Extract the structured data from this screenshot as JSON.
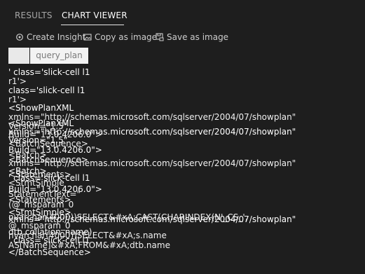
{
  "tabs": {
    "results": "RESULTS",
    "chart_viewer": "CHART VIEWER"
  },
  "toolbar": {
    "create_insight": "Create Insight",
    "copy_as_image": "Copy as image",
    "save_as_image": "Save as image"
  },
  "grid": {
    "column_header": "query_plan"
  },
  "overflow_text": [
    "' class='slick-cell l1",
    "r1'>",
    "  class='slick-cell l1",
    "r1'>",
    "<ShowPlanXML",
    "xmlns=\"http://schemas.microsoft.com/sqlserver/2004/07/showplan\"",
    "<ShowPlanXML",
    "Version=\"1.5\"",
    "xmlns=\"http://schemas.microsoft.com/sqlserver/2004/07/showplan\"",
    "Build=\"13.0.4206.0\">",
    "Version=\"1.5\"",
    "<BatchSequence>",
    "Build=\"13.0.4206.0\">",
    "<Batch>",
    "<BatchSequence>",
    "xmlns=\"http://schemas.microsoft.com/sqlserver/2004/07/showplan\"",
    "<Batch>",
    "<Statements>",
    "' class='slick-cell l1",
    "<StmtSimple",
    "Build=\"13.0.4206.0\">",
    "StatementText=\"",
    "<Statements>",
    "(@_msparam_0",
    "<StmtSimple>",
    "nvarchar(4000))SELECT&#xA;CAST(CHARINDEX(N'_CS_',",
    "xmlns=\"http://schemas.microsoft.com/sqlserver/2004/07/showplan\"",
    "@_msparam_0",
    "dtb.collation_name)",
    "nvarchar(4000))SELECT&#xA;s.name",
    "' class='slick-cell l1",
    "AS[Name]&#xA;FROM&#xA;dtb.name",
    "</BatchSequence>"
  ]
}
